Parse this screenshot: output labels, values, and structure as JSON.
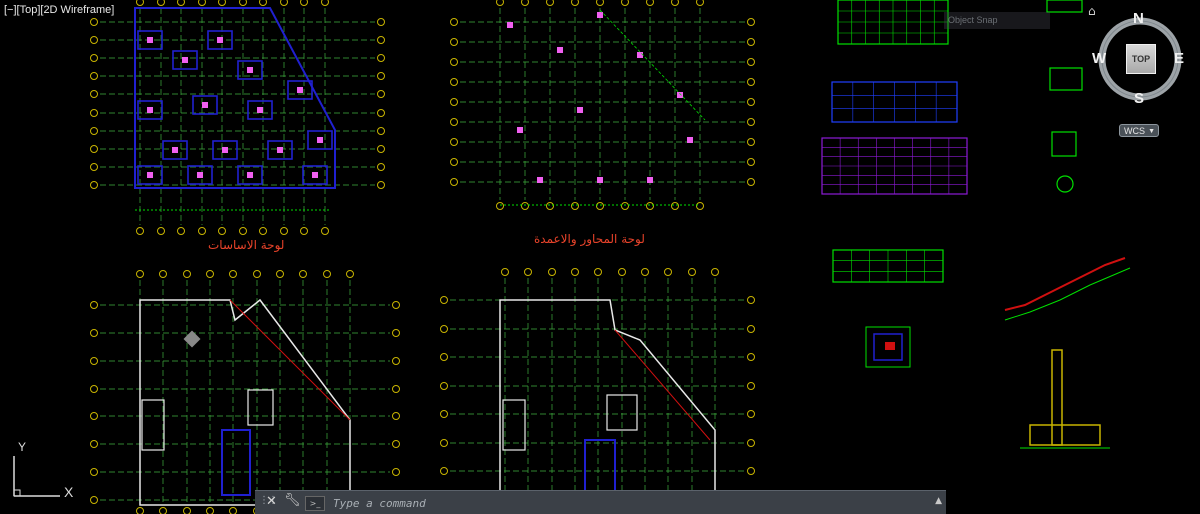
{
  "viewport": {
    "label": "[−][Top][2D Wireframe]"
  },
  "plans": {
    "foundation_title": "لوحة الاساسات",
    "axes_title": "لوحة المحاور والاعمدة"
  },
  "viewcube": {
    "north": "N",
    "south": "S",
    "east": "E",
    "west": "W",
    "face": "TOP"
  },
  "wcs": {
    "label": "WCS"
  },
  "snap_hint": {
    "label": "Object Snap"
  },
  "ucs": {
    "x": "X",
    "y": "Y"
  },
  "command": {
    "placeholder": "Type a command"
  },
  "colors": {
    "grid_green": "#3fae3f",
    "axis_yellow": "#c8b400",
    "column_blue": "#2020d0",
    "annot_green": "#00e000",
    "title_red": "#e8432a",
    "wall_white": "#e8e8e8",
    "table_purple": "#8c1bd6",
    "table_blue": "#2040ff"
  }
}
